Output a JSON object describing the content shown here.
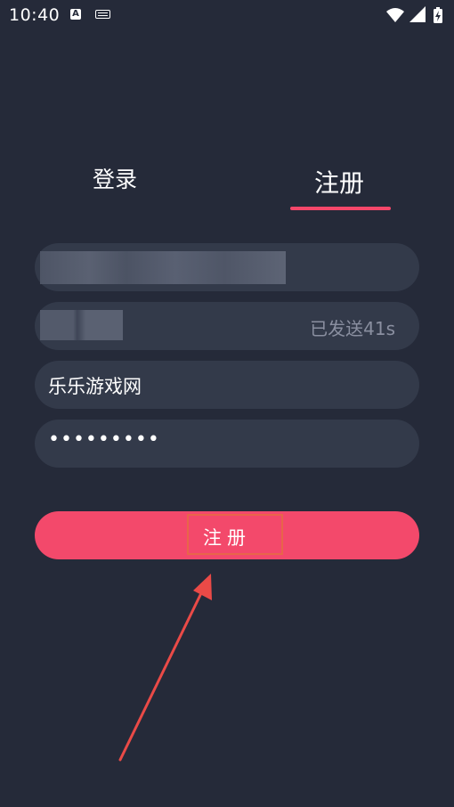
{
  "status_bar": {
    "time": "10:40",
    "notification_icon": "A",
    "keyboard_icon": "keyboard-icon",
    "wifi_icon": "wifi-icon",
    "signal_icon": "signal-icon",
    "battery_icon": "battery-charging-icon"
  },
  "tabs": {
    "login_label": "登录",
    "register_label": "注册",
    "active": "register"
  },
  "form": {
    "phone_value": "",
    "code_value": "",
    "code_send_status": "已发送41s",
    "nickname_value": "乐乐游戏网",
    "password_masked": "•••••••••"
  },
  "submit": {
    "label": "注册"
  },
  "colors": {
    "background": "#252a39",
    "field": "#333a4a",
    "accent": "#f5476a",
    "annotation": "#e8654a"
  }
}
